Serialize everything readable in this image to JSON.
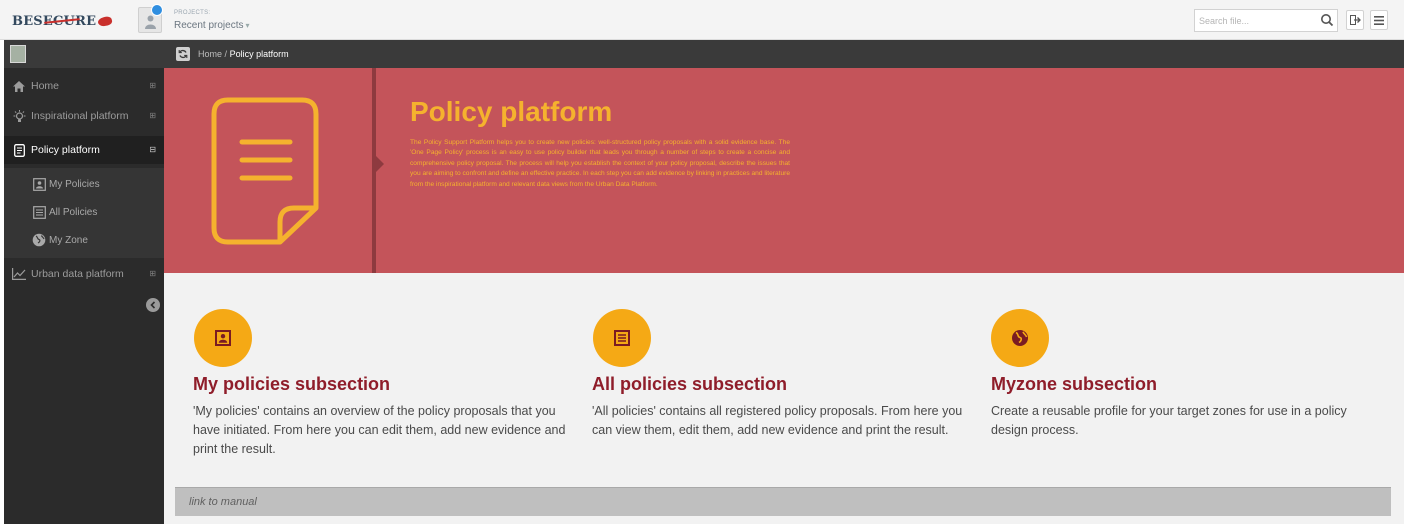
{
  "header": {
    "logo_text": "BESECURE",
    "projects_label": "PROJECTS:",
    "projects_value": "Recent projects",
    "projects_caret": "▾",
    "search_placeholder": "Search file..."
  },
  "breadcrumb": {
    "home": "Home",
    "separator": "/",
    "current": "Policy platform"
  },
  "sidebar": {
    "items": [
      {
        "label": "Home",
        "icon": "home-icon",
        "expander": "⊞"
      },
      {
        "label": "Inspirational platform",
        "icon": "lightbulb-icon",
        "expander": "⊞"
      },
      {
        "label": "Policy platform",
        "icon": "document-icon",
        "expander": "⊟"
      },
      {
        "label": "Urban data platform",
        "icon": "line-chart-icon",
        "expander": "⊞"
      }
    ],
    "subitems": [
      {
        "label": "My Policies",
        "icon": "user-document-icon"
      },
      {
        "label": "All Policies",
        "icon": "list-document-icon"
      },
      {
        "label": "My Zone",
        "icon": "globe-icon"
      }
    ]
  },
  "hero": {
    "title": "Policy platform",
    "text": "The Policy Support Platform helps you to create new policies: well-structured policy proposals with a solid evidence base. The 'One Page Policy' process is an easy to use policy builder that leads you through a number of steps to create a concise and comprehensive policy proposal. The process will help you establish the context of your policy proposal, describe the issues that you are aiming to confront and define an effective practice. In each step you can add evidence by linking in practices and literature from the inspirational platform and relevant data views from the Urban Data Platform."
  },
  "sections": [
    {
      "title": "My policies subsection",
      "icon": "user-document-icon",
      "description": "'My policies' contains an overview of the policy proposals that you have initiated. From here you can edit them, add new evidence and print the result."
    },
    {
      "title": "All policies subsection",
      "icon": "list-document-icon",
      "description": "'All policies' contains all registered policy proposals. From here you can view them, edit them, add new evidence and print the result."
    },
    {
      "title": "Myzone subsection",
      "icon": "globe-icon",
      "description": "Create a reusable profile for your target zones for use in a policy design process."
    }
  ],
  "manual": {
    "link_text": "link to manual"
  },
  "colors": {
    "hero_bg": "#c4545a",
    "accent_yellow": "#f5b22e",
    "section_title": "#8f1d2a",
    "sidebar_bg": "#2b2b2b"
  }
}
